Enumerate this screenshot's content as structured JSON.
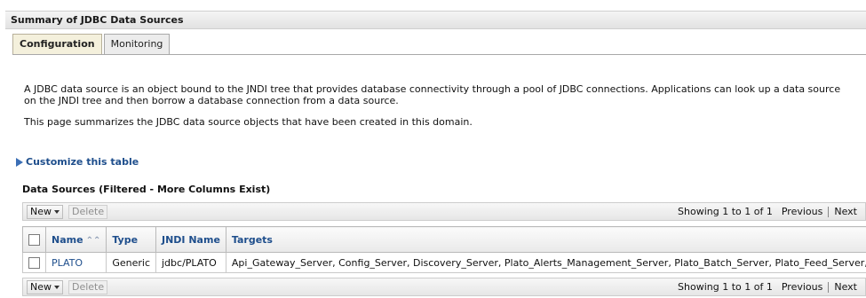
{
  "header": {
    "title": "Summary of JDBC Data Sources"
  },
  "tabs": [
    {
      "label": "Configuration",
      "active": true
    },
    {
      "label": "Monitoring",
      "active": false
    }
  ],
  "description": {
    "paragraph1": "A JDBC data source is an object bound to the JNDI tree that provides database connectivity through a pool of JDBC connections. Applications can look up a data source on the JNDI tree and then borrow a database connection from a data source.",
    "paragraph2": "This page summarizes the JDBC data source objects that have been created in this domain."
  },
  "customize": {
    "label": "Customize this table"
  },
  "table_section": {
    "title": "Data Sources (Filtered - More Columns Exist)"
  },
  "toolbar": {
    "new_label": "New",
    "delete_label": "Delete",
    "showing": "Showing 1 to 1 of 1",
    "previous": "Previous",
    "next": "Next"
  },
  "table": {
    "headers": [
      "Name",
      "Type",
      "JNDI Name",
      "Targets"
    ],
    "rows": [
      {
        "name": "PLATO",
        "type": "Generic",
        "jndi": "jdbc/PLATO",
        "targets": "Api_Gateway_Server, Config_Server, Discovery_Server, Plato_Alerts_Management_Server, Plato_Batch_Server, Plato_Feed_Server, ..."
      }
    ]
  },
  "colors": {
    "link": "#1e4e8c",
    "active_tab": "#f4f0dc"
  },
  "icons": {
    "customize": "expand-triangle-icon",
    "sort": "sort-ascending-icon",
    "dropdown": "caret-down-icon"
  }
}
